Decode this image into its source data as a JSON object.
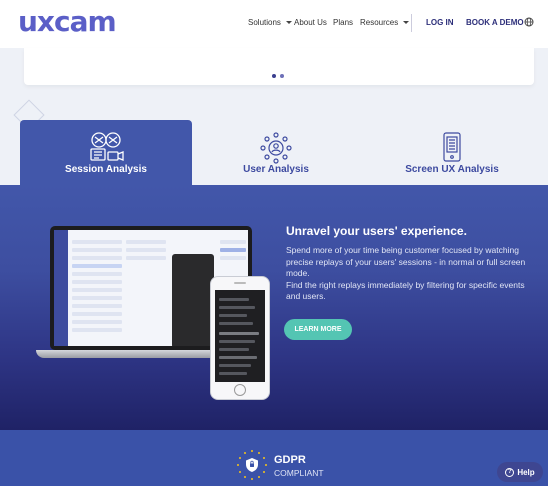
{
  "header": {
    "logo": "uxcam",
    "nav": [
      {
        "label": "Solutions",
        "dropdown": true
      },
      {
        "label": "About Us",
        "dropdown": false
      },
      {
        "label": "Plans",
        "dropdown": false
      },
      {
        "label": "Resources",
        "dropdown": true
      }
    ],
    "login": "LOG IN",
    "demo": "BOOK A DEMO",
    "globe_icon": "globe-icon"
  },
  "slider": {
    "dots": 2
  },
  "tabs": [
    {
      "label": "Session Analysis",
      "icon": "session-analysis-icon",
      "active": true
    },
    {
      "label": "User Analysis",
      "icon": "user-analysis-icon",
      "active": false
    },
    {
      "label": "Screen UX Analysis",
      "icon": "screen-ux-icon",
      "active": false
    }
  ],
  "main": {
    "title": "Unravel your users' experience.",
    "description_1": "Spend more of your time being customer focused by watching precise replays of your users' sessions - in normal or full screen mode.",
    "description_2": "Find the right replays immediately by filtering for specific events and users.",
    "cta": "LEARN MORE"
  },
  "gdpr": {
    "title": "GDPR",
    "subtitle": "COMPLIANT"
  },
  "help": {
    "label": "Help"
  },
  "colors": {
    "brand": "#5b5fc7",
    "tab_active": "#4257aa",
    "cta": "#54c5b3",
    "footer": "#3a52a8"
  }
}
